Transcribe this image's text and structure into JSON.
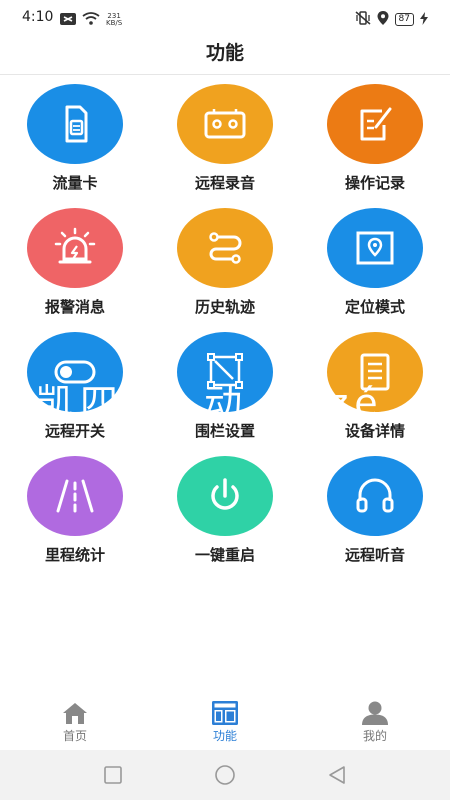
{
  "status_bar": {
    "time": "4:10",
    "net_speed_value": "231",
    "net_speed_unit": "KB/S",
    "battery": "87"
  },
  "header": {
    "title": "功能"
  },
  "features": [
    {
      "label": "流量卡",
      "icon": "sim-card-icon",
      "color": "#1a8ee6"
    },
    {
      "label": "远程录音",
      "icon": "cassette-tape-icon",
      "color": "#f0a21f"
    },
    {
      "label": "操作记录",
      "icon": "edit-record-icon",
      "color": "#ec7b14"
    },
    {
      "label": "报警消息",
      "icon": "alarm-light-icon",
      "color": "#ef6466"
    },
    {
      "label": "历史轨迹",
      "icon": "track-path-icon",
      "color": "#f0a21f"
    },
    {
      "label": "定位模式",
      "icon": "map-pin-icon",
      "color": "#1a8ee6"
    },
    {
      "label": "远程开关",
      "icon": "toggle-switch-icon",
      "color": "#1a8ee6"
    },
    {
      "label": "围栏设置",
      "icon": "fence-polygon-icon",
      "color": "#1a8ee6"
    },
    {
      "label": "设备详情",
      "icon": "device-detail-icon",
      "color": "#f0a21f"
    },
    {
      "label": "里程统计",
      "icon": "road-icon",
      "color": "#b06ae0"
    },
    {
      "label": "一键重启",
      "icon": "power-icon",
      "color": "#2fd2a6"
    },
    {
      "label": "远程听音",
      "icon": "headphones-icon",
      "color": "#1a8ee6"
    }
  ],
  "watermark": "安凯四 生 动 博 zé",
  "bottom_nav": {
    "items": [
      {
        "label": "首页",
        "icon": "home-icon"
      },
      {
        "label": "功能",
        "icon": "function-grid-icon"
      },
      {
        "label": "我的",
        "icon": "profile-icon"
      }
    ],
    "active": "功能",
    "active_color": "#2c7fd6"
  }
}
